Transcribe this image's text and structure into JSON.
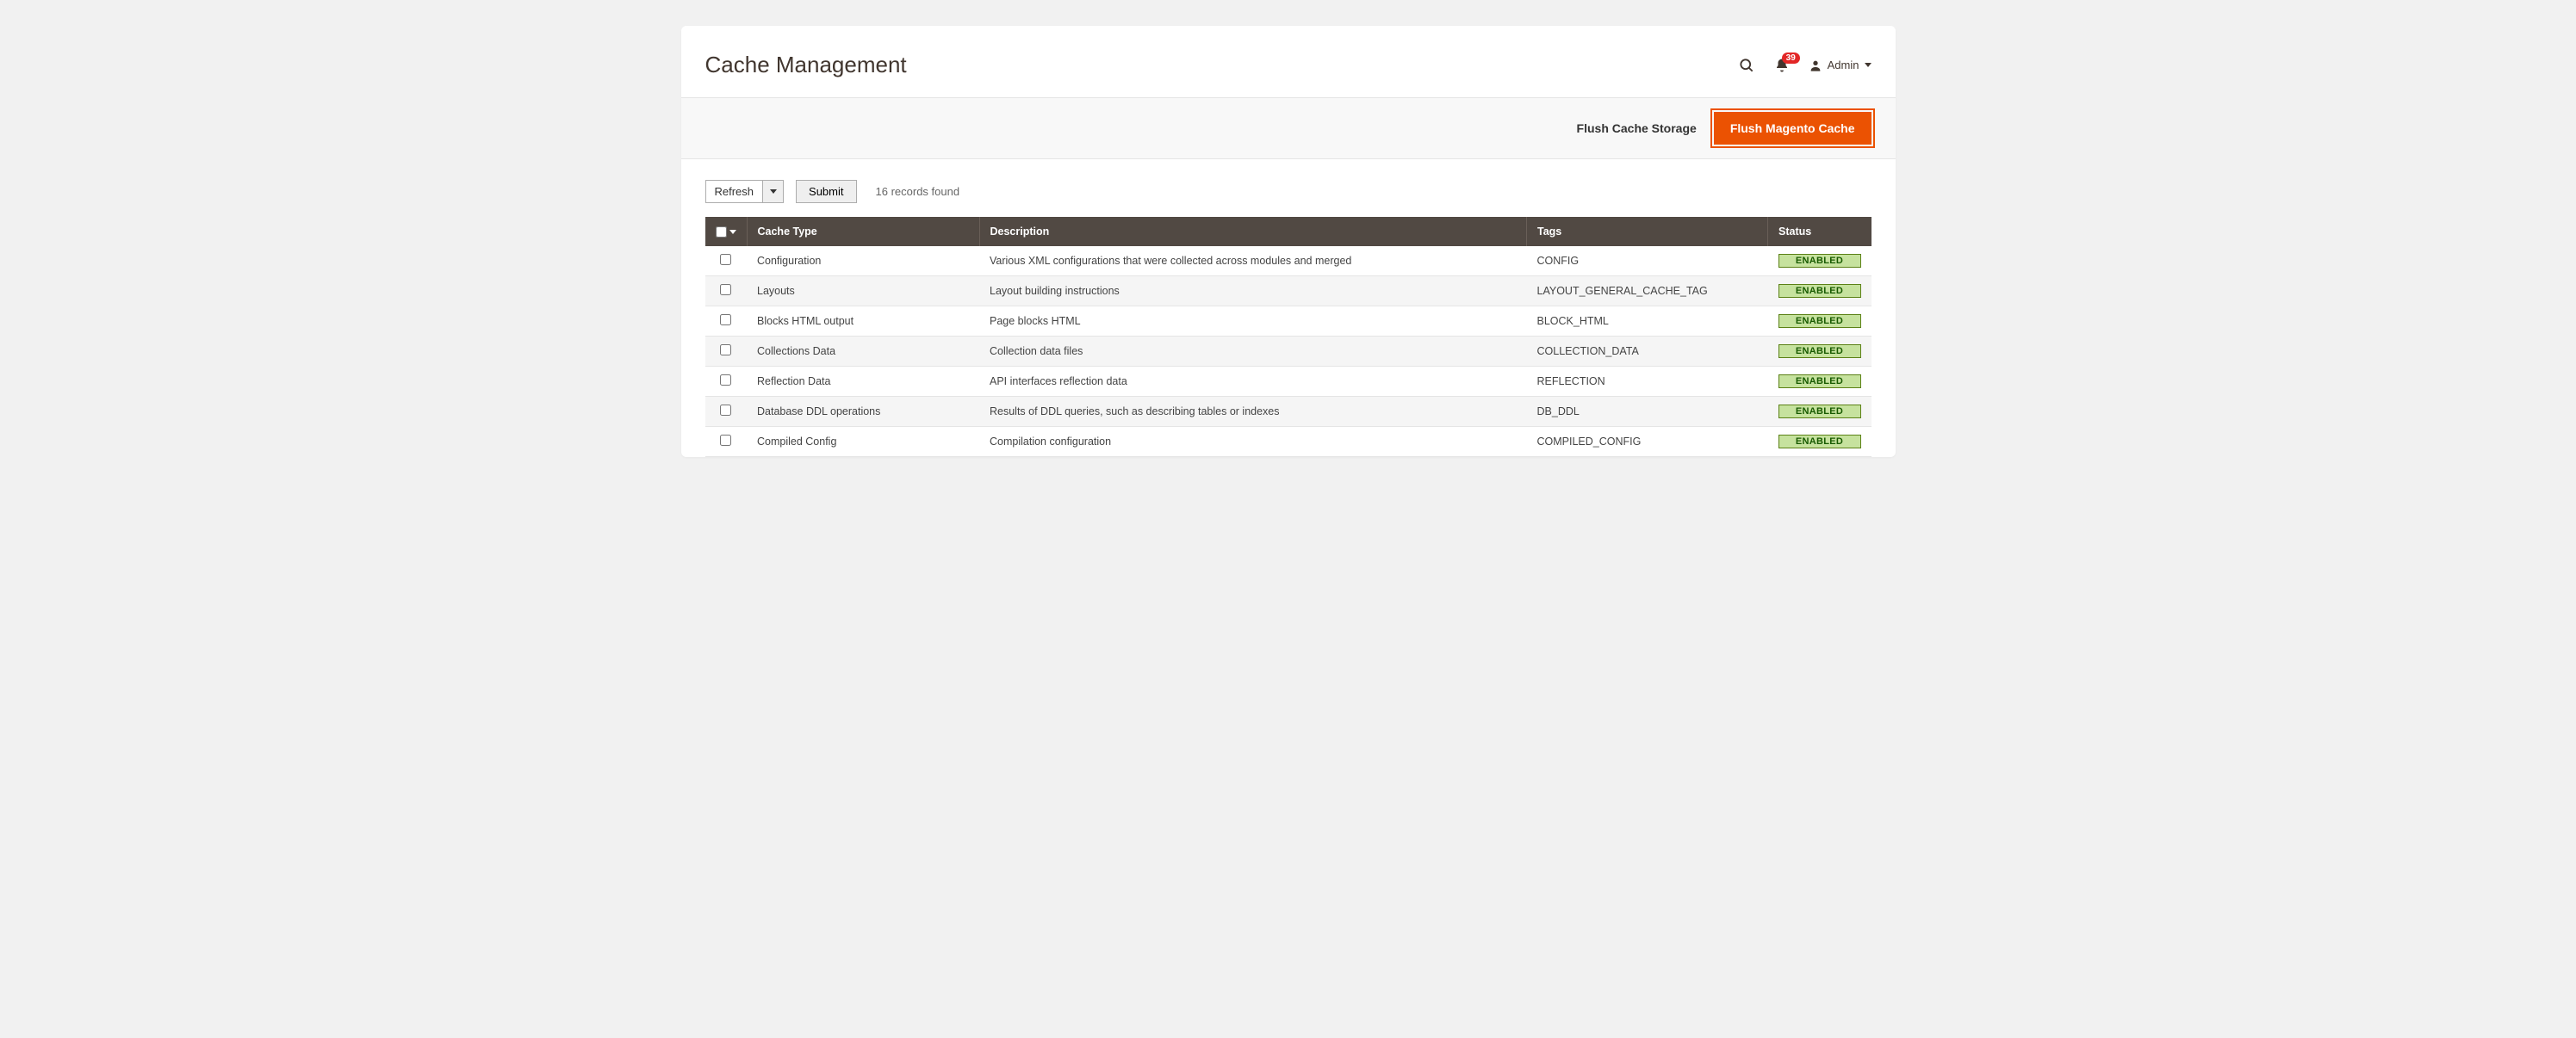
{
  "header": {
    "title": "Cache Management",
    "notif_count": "39",
    "admin_label": "Admin"
  },
  "actions": {
    "flush_storage": "Flush Cache Storage",
    "flush_magento": "Flush Magento Cache"
  },
  "toolbar": {
    "action_select": "Refresh",
    "submit": "Submit",
    "records": "16 records found"
  },
  "columns": {
    "type": "Cache Type",
    "description": "Description",
    "tags": "Tags",
    "status": "Status"
  },
  "status_label": "ENABLED",
  "rows": [
    {
      "type": "Configuration",
      "desc": "Various XML configurations that were collected across modules and merged",
      "tags": "CONFIG"
    },
    {
      "type": "Layouts",
      "desc": "Layout building instructions",
      "tags": "LAYOUT_GENERAL_CACHE_TAG"
    },
    {
      "type": "Blocks HTML output",
      "desc": "Page blocks HTML",
      "tags": "BLOCK_HTML"
    },
    {
      "type": "Collections Data",
      "desc": "Collection data files",
      "tags": "COLLECTION_DATA"
    },
    {
      "type": "Reflection Data",
      "desc": "API interfaces reflection data",
      "tags": "REFLECTION"
    },
    {
      "type": "Database DDL operations",
      "desc": "Results of DDL queries, such as describing tables or indexes",
      "tags": "DB_DDL"
    },
    {
      "type": "Compiled Config",
      "desc": "Compilation configuration",
      "tags": "COMPILED_CONFIG"
    }
  ]
}
